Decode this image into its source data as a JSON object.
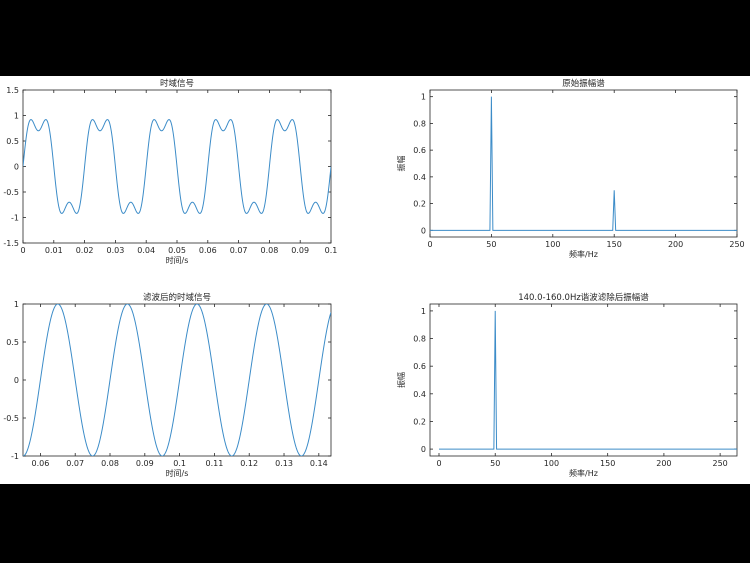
{
  "chart_data": [
    {
      "type": "line",
      "title": "时域信号",
      "xlabel": "时间/s",
      "ylabel": "",
      "xlim": [
        0,
        0.1
      ],
      "ylim": [
        -1.5,
        1.5
      ],
      "xticks": [
        "0",
        "0.01",
        "0.02",
        "0.03",
        "0.04",
        "0.05",
        "0.06",
        "0.07",
        "0.08",
        "0.09",
        "0.1"
      ],
      "yticks": [
        "-1.5",
        "-1",
        "-0.5",
        "0",
        "0.5",
        "1",
        "1.5"
      ],
      "series": [
        {
          "components": [
            {
              "amplitude": 1.0,
              "frequency_hz": 50
            },
            {
              "amplitude": 0.3,
              "frequency_hz": 150
            }
          ],
          "x_range": [
            0,
            0.1
          ]
        }
      ],
      "color": "#3c8cc8"
    },
    {
      "type": "line",
      "title": "原始振幅谱",
      "xlabel": "频率/Hz",
      "ylabel": "振幅",
      "xlim": [
        0,
        250
      ],
      "ylim": [
        -0.05,
        1.05
      ],
      "xticks": [
        "0",
        "50",
        "100",
        "150",
        "200",
        "250"
      ],
      "yticks": [
        "0",
        "0.2",
        "0.4",
        "0.6",
        "0.8",
        "1"
      ],
      "series": [
        {
          "peaks": [
            {
              "x": 50,
              "y": 1.0
            },
            {
              "x": 150,
              "y": 0.3
            }
          ],
          "baseline": 0,
          "x_range": [
            0,
            250
          ]
        }
      ],
      "color": "#3c8cc8"
    },
    {
      "type": "line",
      "title": "滤波后的时域信号",
      "xlabel": "时间/s",
      "ylabel": "",
      "xlim": [
        0.055,
        0.1435
      ],
      "ylim": [
        -1,
        1
      ],
      "xticks": [
        "0.06",
        "0.07",
        "0.08",
        "0.09",
        "0.1",
        "0.11",
        "0.12",
        "0.13",
        "0.14"
      ],
      "yticks": [
        "-1",
        "-0.5",
        "0",
        "0.5",
        "1"
      ],
      "series": [
        {
          "components": [
            {
              "amplitude": 1.0,
              "frequency_hz": 50
            }
          ],
          "x_range": [
            0.055,
            0.1435
          ]
        }
      ],
      "color": "#3c8cc8"
    },
    {
      "type": "line",
      "title": "140.0-160.0Hz谐波滤除后振幅谱",
      "xlabel": "频率/Hz",
      "ylabel": "振幅",
      "xlim": [
        -8,
        265
      ],
      "ylim": [
        -0.05,
        1.05
      ],
      "xticks": [
        "0",
        "50",
        "100",
        "150",
        "200",
        "250"
      ],
      "yticks": [
        "0",
        "0.2",
        "0.4",
        "0.6",
        "0.8",
        "1"
      ],
      "series": [
        {
          "peaks": [
            {
              "x": 50,
              "y": 1.0
            }
          ],
          "baseline": 0,
          "x_range": [
            0,
            265
          ]
        }
      ],
      "color": "#3c8cc8"
    }
  ]
}
